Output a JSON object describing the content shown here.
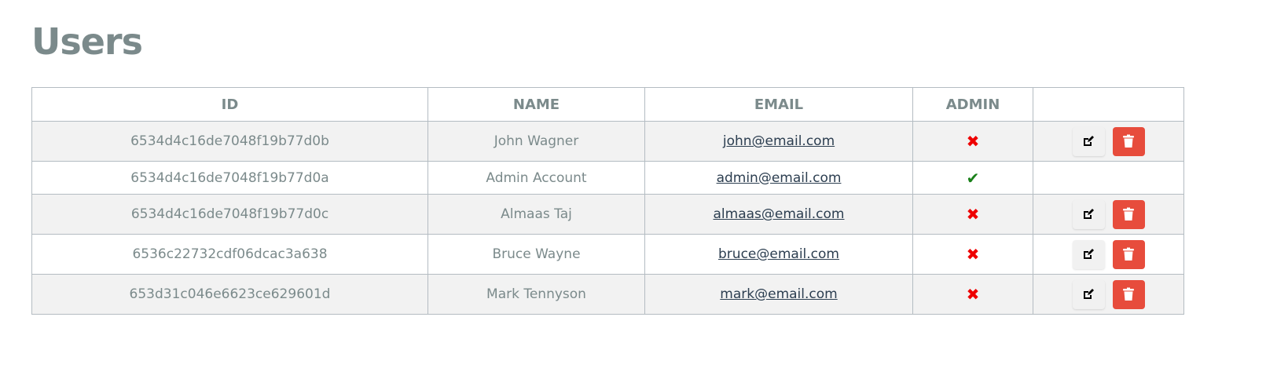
{
  "title": "Users",
  "columns": [
    "ID",
    "NAME",
    "EMAIL",
    "ADMIN",
    ""
  ],
  "rows": [
    {
      "id": "6534d4c16de7048f19b77d0b",
      "name": "John Wagner",
      "email": "john@email.com",
      "admin": false
    },
    {
      "id": "6534d4c16de7048f19b77d0a",
      "name": "Admin Account",
      "email": "admin@email.com",
      "admin": true
    },
    {
      "id": "6534d4c16de7048f19b77d0c",
      "name": "Almaas Taj",
      "email": "almaas@email.com",
      "admin": false
    },
    {
      "id": "6536c22732cdf06dcac3a638",
      "name": "Bruce Wayne",
      "email": "bruce@email.com",
      "admin": false
    },
    {
      "id": "653d31c046e6623ce629601d",
      "name": "Mark Tennyson",
      "email": "mark@email.com",
      "admin": false
    }
  ],
  "colors": {
    "text": "#7b8a8b",
    "link": "#2c3e50",
    "danger": "#e74c3c",
    "border": "#b4bcc2"
  }
}
